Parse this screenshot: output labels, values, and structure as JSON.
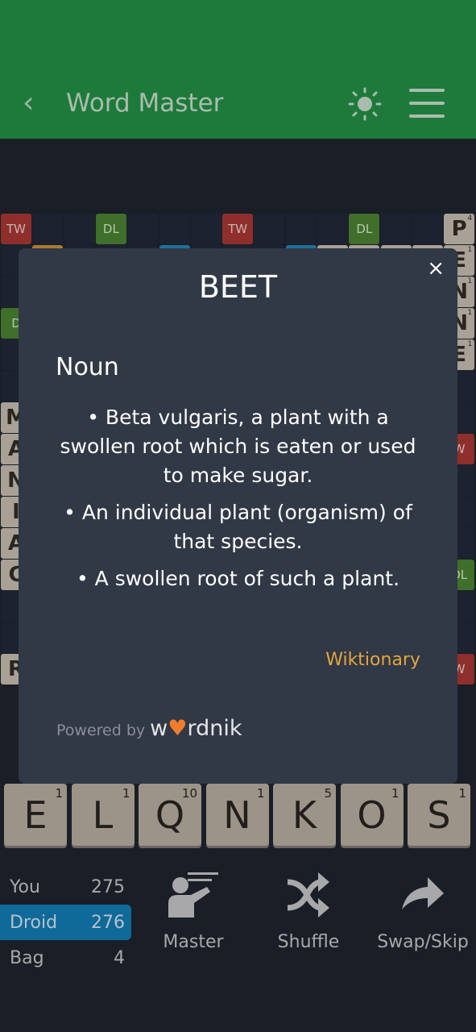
{
  "header": {
    "title": "Word Master",
    "back_icon": "chevron-left-icon",
    "theme_icon": "sun-icon",
    "menu_icon": "hamburger-icon"
  },
  "board": {
    "premiums": [
      {
        "r": 0,
        "c": 0,
        "type": "TW",
        "label": "TW"
      },
      {
        "r": 0,
        "c": 3,
        "type": "DL",
        "label": "DL"
      },
      {
        "r": 0,
        "c": 7,
        "type": "TW",
        "label": "TW"
      },
      {
        "r": 0,
        "c": 11,
        "type": "DL",
        "label": "DL"
      },
      {
        "r": 1,
        "c": 1,
        "type": "DW",
        "label": ""
      },
      {
        "r": 1,
        "c": 5,
        "type": "TL",
        "label": ""
      },
      {
        "r": 1,
        "c": 9,
        "type": "TL",
        "label": ""
      },
      {
        "r": 3,
        "c": 0,
        "type": "DL",
        "label": "D"
      },
      {
        "r": 7,
        "c": 14,
        "type": "TW",
        "label": "W"
      },
      {
        "r": 11,
        "c": 14,
        "type": "DL",
        "label": "DL"
      },
      {
        "r": 14,
        "c": 14,
        "type": "TW",
        "label": "W"
      }
    ],
    "tiles": [
      {
        "r": 0,
        "c": 14,
        "letter": "P",
        "points": "4"
      },
      {
        "r": 1,
        "c": 14,
        "letter": "E",
        "points": "1"
      },
      {
        "r": 2,
        "c": 14,
        "letter": "N",
        "points": "1"
      },
      {
        "r": 3,
        "c": 14,
        "letter": "N",
        "points": "1"
      },
      {
        "r": 4,
        "c": 14,
        "letter": "E",
        "points": "1"
      },
      {
        "r": 1,
        "c": 10,
        "letter": "",
        "points": ""
      },
      {
        "r": 1,
        "c": 11,
        "letter": "",
        "points": ""
      },
      {
        "r": 1,
        "c": 12,
        "letter": "",
        "points": ""
      },
      {
        "r": 1,
        "c": 13,
        "letter": "",
        "points": ""
      },
      {
        "r": 6,
        "c": 0,
        "letter": "M",
        "points": ""
      },
      {
        "r": 7,
        "c": 0,
        "letter": "A",
        "points": ""
      },
      {
        "r": 8,
        "c": 0,
        "letter": "N",
        "points": ""
      },
      {
        "r": 9,
        "c": 0,
        "letter": "I",
        "points": ""
      },
      {
        "r": 10,
        "c": 0,
        "letter": "A",
        "points": ""
      },
      {
        "r": 11,
        "c": 0,
        "letter": "C",
        "points": ""
      },
      {
        "r": 14,
        "c": 0,
        "letter": "R",
        "points": ""
      }
    ]
  },
  "dialog": {
    "word": "BEET",
    "close_label": "×",
    "part_of_speech": "Noun",
    "definitions": [
      "• Beta vulgaris, a plant with a swollen root which is eaten or used to make sugar.",
      "• An individual plant (organism) of that species.",
      "• A swollen root of such a plant."
    ],
    "source": "Wiktionary",
    "powered_by": "Powered by",
    "brand_a": "w",
    "brand_heart": "♥",
    "brand_b": "rdnik"
  },
  "rack": [
    {
      "letter": "E",
      "points": "1"
    },
    {
      "letter": "L",
      "points": "1"
    },
    {
      "letter": "Q",
      "points": "10"
    },
    {
      "letter": "N",
      "points": "1"
    },
    {
      "letter": "K",
      "points": "5"
    },
    {
      "letter": "O",
      "points": "1"
    },
    {
      "letter": "S",
      "points": "1"
    }
  ],
  "scores": [
    {
      "label": "You",
      "value": "275"
    },
    {
      "label": "Droid",
      "value": "276",
      "active": true
    },
    {
      "label": "Bag",
      "value": "4"
    }
  ],
  "actions": {
    "master": "Master",
    "shuffle": "Shuffle",
    "swap": "Swap/Skip"
  },
  "colors": {
    "header": "#1e7a3b",
    "active_player": "#0f6a9a",
    "source_link": "#e4a53e"
  }
}
